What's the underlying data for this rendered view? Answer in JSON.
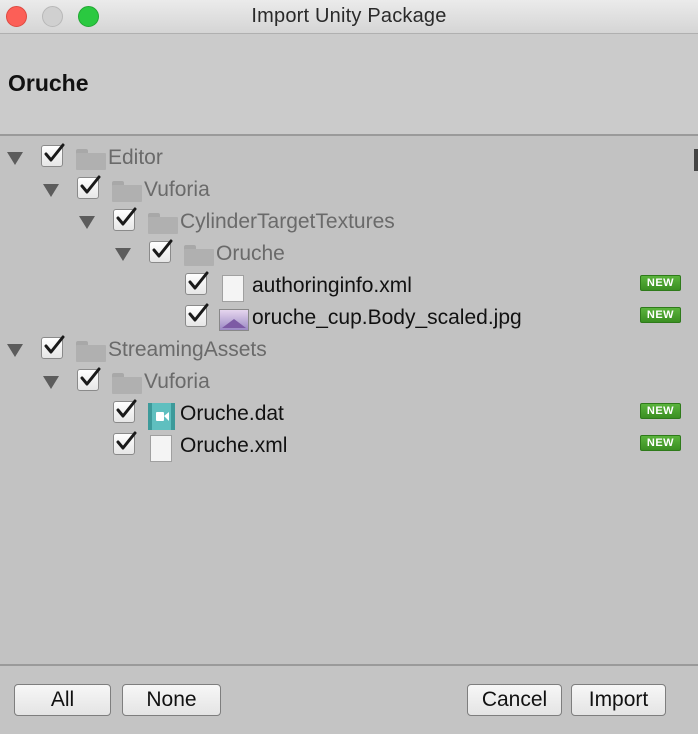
{
  "window": {
    "title": "Import Unity Package"
  },
  "header": {
    "package_name": "Oruche"
  },
  "tree": [
    {
      "label": "Editor",
      "type": "folder",
      "checked": true,
      "expanded": true
    },
    {
      "label": "Vuforia",
      "type": "folder",
      "checked": true,
      "expanded": true
    },
    {
      "label": "CylinderTargetTextures",
      "type": "folder",
      "checked": true,
      "expanded": true
    },
    {
      "label": "Oruche",
      "type": "folder",
      "checked": true,
      "expanded": true
    },
    {
      "label": "authoringinfo.xml",
      "type": "file",
      "checked": true,
      "badge": "NEW"
    },
    {
      "label": "oruche_cup.Body_scaled.jpg",
      "type": "image",
      "checked": true,
      "badge": "NEW"
    },
    {
      "label": "StreamingAssets",
      "type": "folder",
      "checked": true,
      "expanded": true
    },
    {
      "label": "Vuforia",
      "type": "folder",
      "checked": true,
      "expanded": true
    },
    {
      "label": "Oruche.dat",
      "type": "video",
      "checked": true,
      "badge": "NEW"
    },
    {
      "label": "Oruche.xml",
      "type": "file",
      "checked": true,
      "badge": "NEW"
    }
  ],
  "footer": {
    "all_label": "All",
    "none_label": "None",
    "cancel_label": "Cancel",
    "import_label": "Import"
  },
  "colors": {
    "badge_new": "#3fa02a",
    "checkmark": "#1a1a1a",
    "folder_label": "#6a6a6a",
    "file_label": "#111111"
  },
  "icons": {
    "close": "close-icon",
    "minimize": "minimize-icon",
    "zoom": "zoom-icon",
    "expand": "expand-triangle-icon",
    "check": "checkmark-icon",
    "folder": "folder-icon",
    "file": "file-icon",
    "image": "image-icon",
    "video": "video-icon"
  }
}
